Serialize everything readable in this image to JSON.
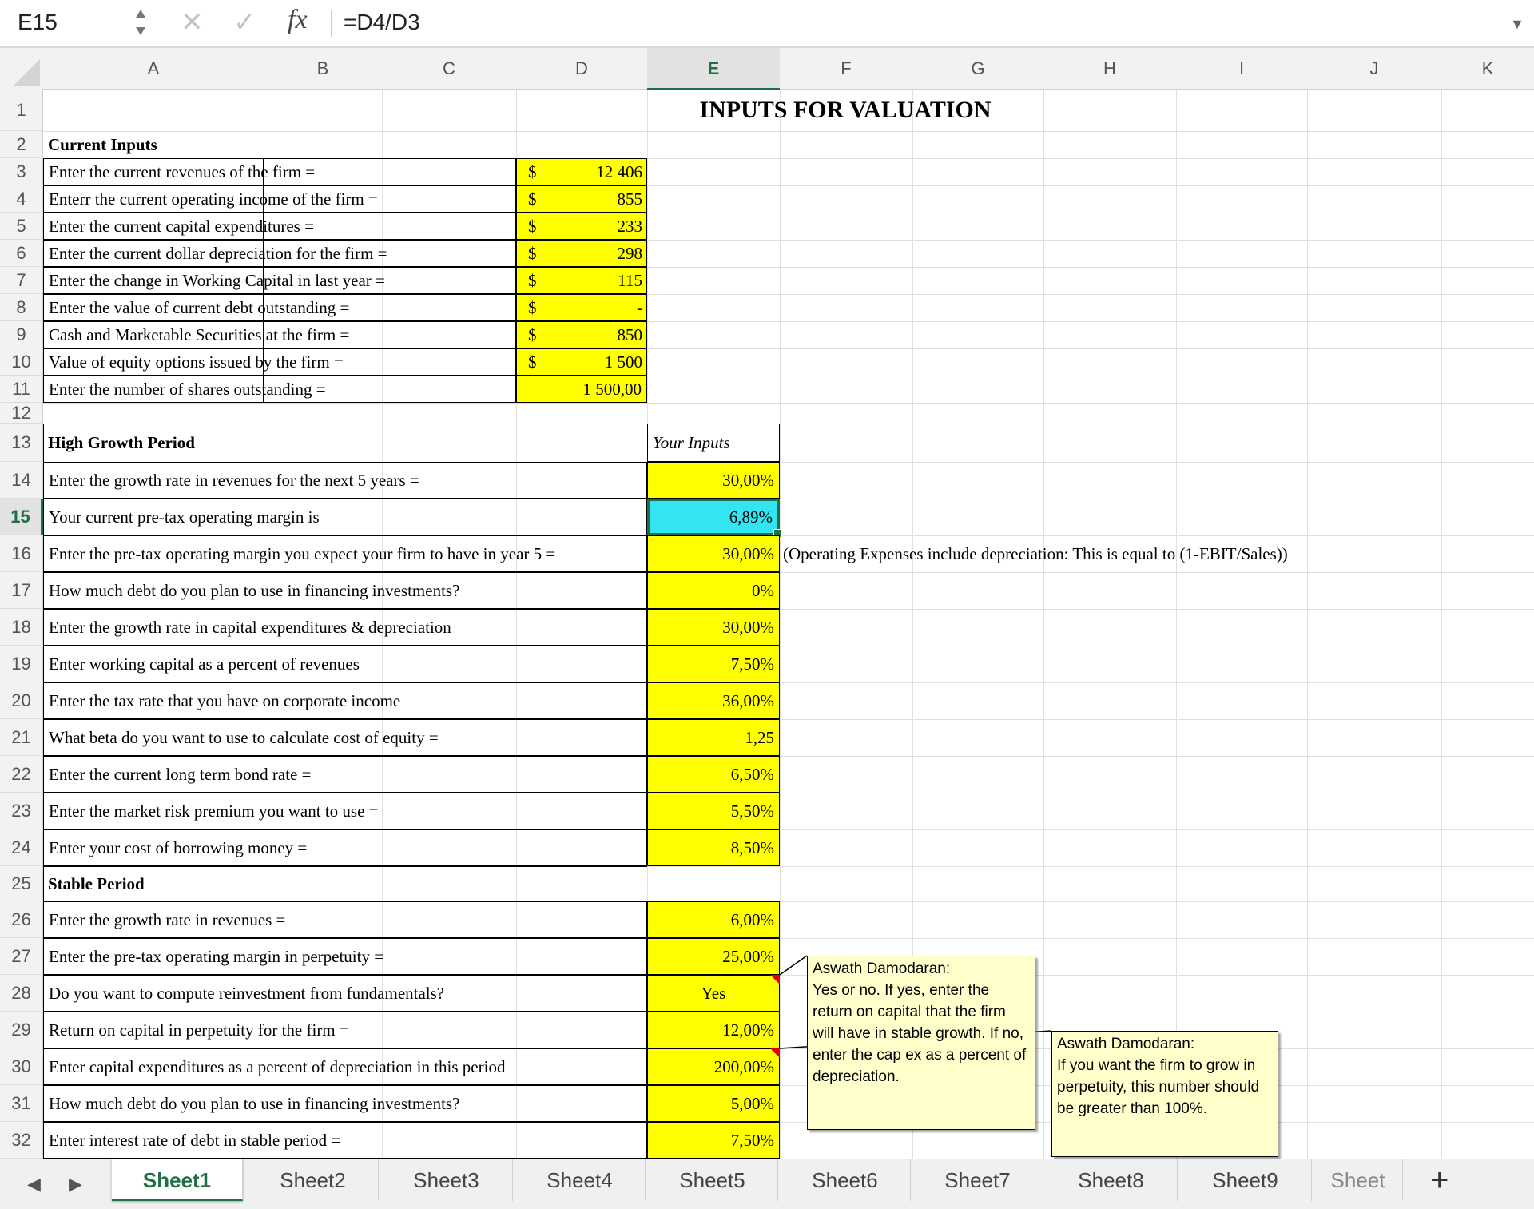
{
  "formula_bar": {
    "name_box": "E15",
    "cancel_glyph": "✕",
    "confirm_glyph": "✓",
    "fx_label": "fx",
    "formula": "=D4/D3"
  },
  "columns": [
    "A",
    "B",
    "C",
    "D",
    "E",
    "F",
    "G",
    "H",
    "I",
    "J",
    "K"
  ],
  "selected_column": "E",
  "rows": [
    "1",
    "2",
    "3",
    "4",
    "5",
    "6",
    "7",
    "8",
    "9",
    "10",
    "11",
    "12",
    "13",
    "14",
    "15",
    "16",
    "17",
    "18",
    "19",
    "20",
    "21",
    "22",
    "23",
    "24",
    "25",
    "26",
    "27",
    "28",
    "29",
    "30",
    "31",
    "32"
  ],
  "selected_row": "15",
  "sheet": {
    "title": "INPUTS FOR VALUATION",
    "current_inputs_header": "Current Inputs",
    "current_inputs": [
      {
        "label": "Enter the current revenues of the firm =",
        "currency": "$",
        "value": "12 406"
      },
      {
        "label": "Enterr the current operating income of the firm =",
        "currency": "$",
        "value": "855"
      },
      {
        "label": "Enter the current capital expenditures =",
        "currency": "$",
        "value": "233"
      },
      {
        "label": "Enter the current dollar depreciation for the firm =",
        "currency": "$",
        "value": "298"
      },
      {
        "label": "Enter the change in Working Capital in last year =",
        "currency": "$",
        "value": "115"
      },
      {
        "label": "Enter the value of current debt outstanding =",
        "currency": "$",
        "value": "-"
      },
      {
        "label": "Cash and Marketable Securities at the firm =",
        "currency": "$",
        "value": "850"
      },
      {
        "label": "Value of equity options issued by the firm =",
        "currency": "$",
        "value": "1 500"
      },
      {
        "label": "Enter the number of shares outstanding =",
        "currency": "",
        "value": "1 500,00"
      }
    ],
    "high_growth_header": "High Growth Period",
    "your_inputs_header": "Your Inputs",
    "high_growth": [
      {
        "label": "Enter the growth rate in revenues for the next 5 years =",
        "value": "30,00%"
      },
      {
        "label": "Your current pre-tax operating margin is",
        "value": "6,89%"
      },
      {
        "label": "Enter the pre-tax operating margin you expect your firm to have in year 5 =",
        "value": "30,00%"
      },
      {
        "label": "How much debt do you plan to use in financing investments?",
        "value": "0%"
      },
      {
        "label": "Enter the growth rate in capital expenditures & depreciation",
        "value": "30,00%"
      },
      {
        "label": "Enter working capital as a percent of revenues",
        "value": "7,50%"
      },
      {
        "label": "Enter the tax rate that you have on corporate income",
        "value": "36,00%"
      },
      {
        "label": "What beta do you want to use to calculate cost of equity =",
        "value": "1,25"
      },
      {
        "label": "Enter the current long term bond rate =",
        "value": "6,50%"
      },
      {
        "label": "Enter the market risk premium you want to use =",
        "value": "5,50%"
      },
      {
        "label": "Enter your cost of borrowing money =",
        "value": "8,50%"
      }
    ],
    "margin_note": "(Operating Expenses include depreciation: This is equal to (1-EBIT/Sales))",
    "stable_header": "Stable Period",
    "stable": [
      {
        "label": "Enter the growth rate in revenues =",
        "value": "6,00%"
      },
      {
        "label": "Enter the pre-tax operating margin in perpetuity =",
        "value": "25,00%"
      },
      {
        "label": "Do you want to compute reinvestment from fundamentals?",
        "value": "Yes"
      },
      {
        "label": "Return on capital in perpetuity for the firm =",
        "value": "12,00%"
      },
      {
        "label": "Enter capital expenditures as a percent of depreciation in this period",
        "value": "200,00%"
      },
      {
        "label": "How much debt do you plan to use in financing investments?",
        "value": "5,00%"
      },
      {
        "label": "Enter interest rate of debt in stable period =",
        "value": "7,50%"
      }
    ]
  },
  "comments": [
    {
      "author": "Aswath Damodaran:",
      "text": "Yes or no. If yes, enter the return on capital that the firm will have in stable growth. If no, enter the cap ex as a percent of depreciation."
    },
    {
      "author": "Aswath Damodaran:",
      "text": "If you want the firm to grow in perpetuity, this number should be greater than 100%."
    }
  ],
  "tabs": [
    "Sheet1",
    "Sheet2",
    "Sheet3",
    "Sheet4",
    "Sheet5",
    "Sheet6",
    "Sheet7",
    "Sheet8",
    "Sheet9",
    "Sheet"
  ],
  "active_tab": "Sheet1",
  "tab_add": "+",
  "colors": {
    "input_yellow": "#ffff00",
    "selected_cyan": "#33e5f2",
    "excel_green": "#1e7145",
    "comment_bg": "#ffffcc"
  }
}
